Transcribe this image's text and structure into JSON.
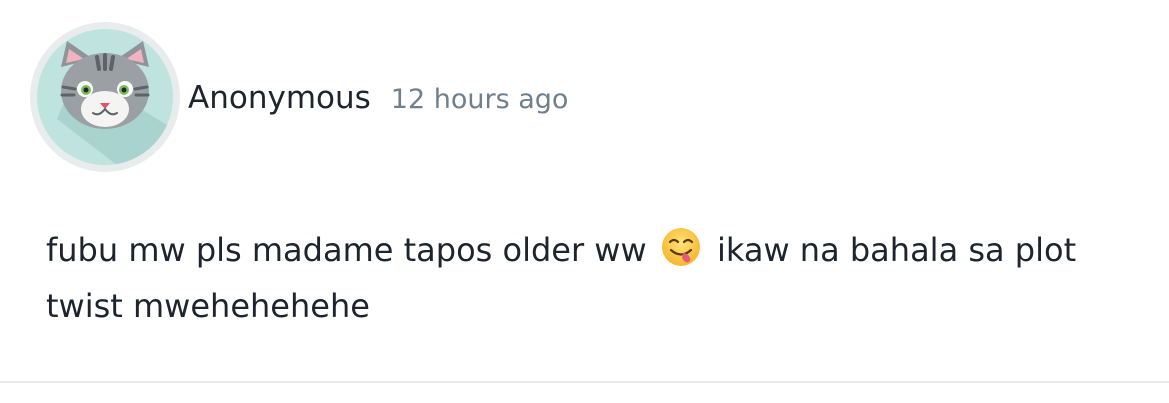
{
  "comment": {
    "author": "Anonymous",
    "timestamp": "12 hours ago",
    "avatar_icon": "cat-avatar-icon",
    "text_part1": "fubu mw pls madame tapos older ww",
    "emoji": "face-savoring-food-emoji",
    "text_part2": "ikaw na bahala sa plot twist mwehehehehe"
  },
  "colors": {
    "avatar_bg": "#bfe3df",
    "avatar_ring": "#e9ecec",
    "timestamp": "#6f7f8c",
    "divider": "#e6e8ea"
  }
}
